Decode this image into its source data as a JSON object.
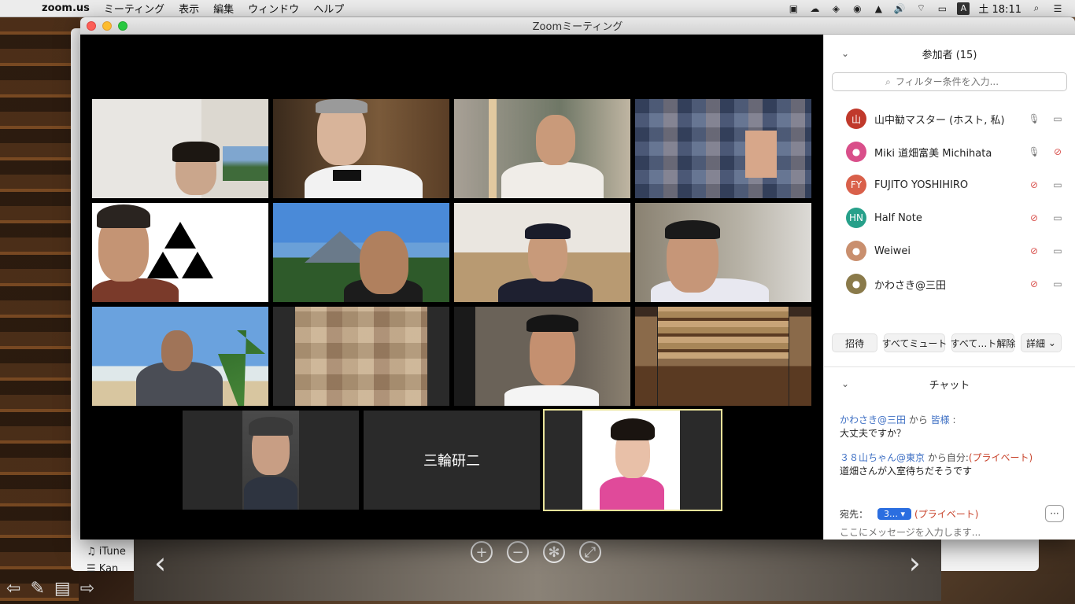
{
  "menubar": {
    "app": "zoom.us",
    "items": [
      "ミーティング",
      "表示",
      "編集",
      "ウィンドウ",
      "ヘルプ"
    ],
    "ime": "A",
    "clock": "土 18:11"
  },
  "background": {
    "sidebar_items": [
      "iTune",
      "Kan"
    ]
  },
  "window": {
    "title": "Zoomミーティング"
  },
  "gallery": {
    "name_tile": "三輪研二"
  },
  "participants": {
    "header": "参加者 (15)",
    "search_placeholder": "フィルター条件を入力...",
    "list": [
      {
        "initials": "山",
        "name": "山中勧マスター (ホスト, 私)",
        "avatar_color": "#c0392b",
        "mic": "on",
        "video": "on"
      },
      {
        "initials": "",
        "name": "Miki 道畑富美 Michihata",
        "avatar_color": "#d94f8a",
        "mic": "on",
        "video": "off"
      },
      {
        "initials": "FY",
        "name": "FUJITO YOSHIHIRO",
        "avatar_color": "#d9604a",
        "mic": "muted",
        "video": "on"
      },
      {
        "initials": "HN",
        "name": "Half Note",
        "avatar_color": "#27a08a",
        "mic": "muted",
        "video": "on"
      },
      {
        "initials": "",
        "name": "Weiwei",
        "avatar_color": "#c98f6e",
        "mic": "muted",
        "video": "on"
      },
      {
        "initials": "",
        "name": "かわさき@三田",
        "avatar_color": "#8a7a4a",
        "mic": "muted",
        "video": "on"
      }
    ],
    "buttons": {
      "invite": "招待",
      "mute_all": "すべてミュート",
      "unmute_all": "すべて…ト解除",
      "more": "詳細"
    }
  },
  "chat": {
    "header": "チャット",
    "messages": [
      {
        "sender": "かわさき@三田",
        "mid": " から ",
        "recipient": "皆様",
        "sep": " :",
        "text": "大丈夫ですか？"
      },
      {
        "sender": "３８山ちゃん@東京",
        "mid": " から自分:",
        "recipient": "(プライベート)",
        "sep": "",
        "text": "道畑さんが入室待ちだそうです"
      }
    ],
    "to_label": "宛先：",
    "to_value": "3…",
    "to_private": "(プライベート)",
    "input_placeholder": "ここにメッセージを入力します..."
  },
  "colors": {
    "accent_blue": "#2b6ee0",
    "private_red": "#c8432b",
    "active_speaker": "#e9e39a"
  }
}
